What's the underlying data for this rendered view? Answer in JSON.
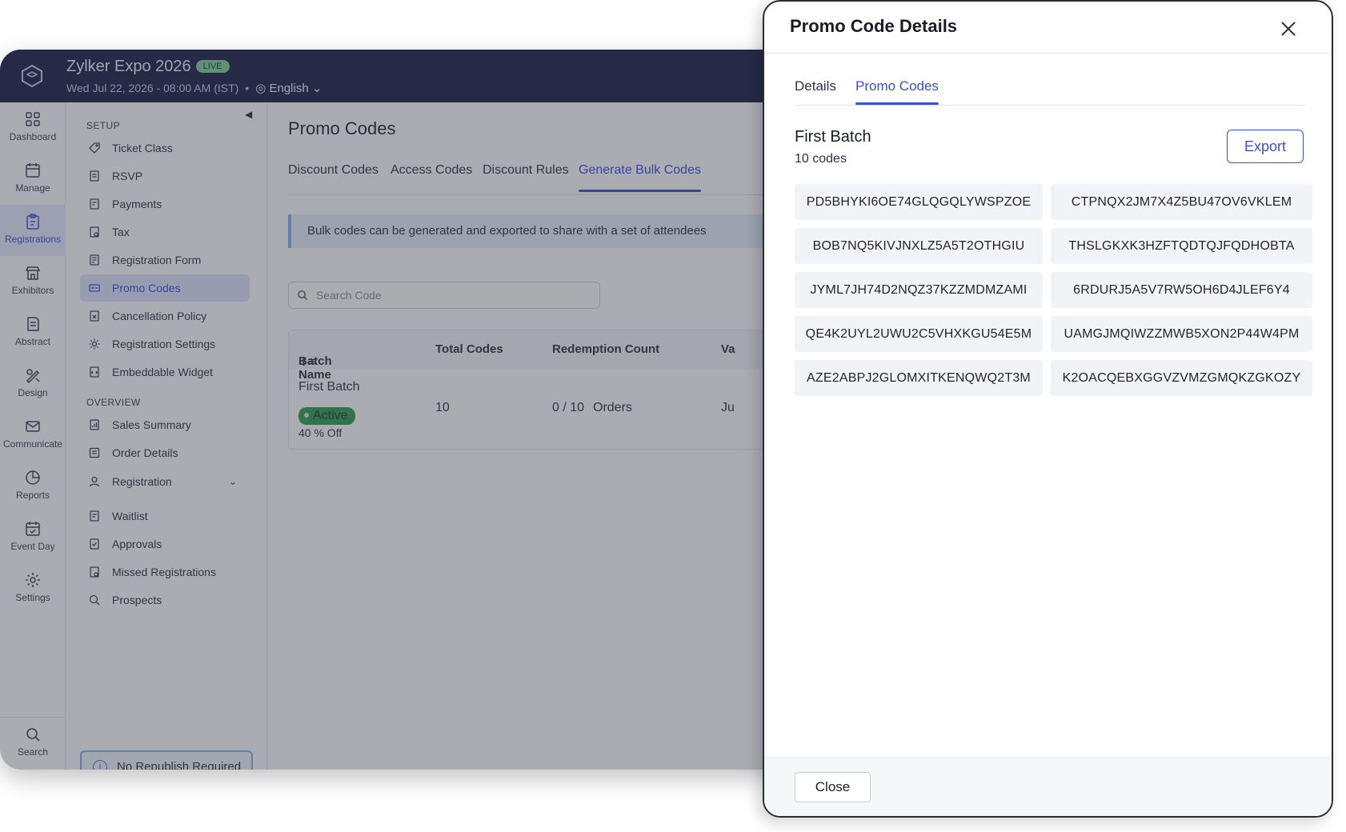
{
  "app": {
    "event_title": "Zylker Expo 2026",
    "live_badge": "LIVE",
    "event_datetime": "Wed Jul 22, 2026 - 08:00 AM (IST)",
    "separator": "•",
    "language": "English"
  },
  "rail": {
    "items": [
      {
        "label": "Dashboard",
        "icon": "dashboard-icon"
      },
      {
        "label": "Manage",
        "icon": "manage-icon"
      },
      {
        "label": "Registrations",
        "icon": "registrations-icon",
        "active": true
      },
      {
        "label": "Exhibitors",
        "icon": "exhibitors-icon"
      },
      {
        "label": "Abstract",
        "icon": "abstract-icon"
      },
      {
        "label": "Design",
        "icon": "design-icon"
      },
      {
        "label": "Communicate",
        "icon": "communicate-icon"
      },
      {
        "label": "Reports",
        "icon": "reports-icon"
      },
      {
        "label": "Event Day",
        "icon": "event-day-icon"
      },
      {
        "label": "Settings",
        "icon": "settings-icon"
      }
    ],
    "search_label": "Search"
  },
  "sidebar": {
    "setup_heading": "SETUP",
    "setup_items": [
      "Ticket Class",
      "RSVP",
      "Payments",
      "Tax",
      "Registration Form",
      "Promo Codes",
      "Cancellation Policy",
      "Registration Settings",
      "Embeddable Widget"
    ],
    "overview_heading": "OVERVIEW",
    "overview_items": [
      "Sales Summary",
      "Order Details",
      "Registration",
      "Waitlist",
      "Approvals",
      "Missed Registrations",
      "Prospects"
    ],
    "active_item": "Promo Codes",
    "republish_label": "No Republish Required"
  },
  "main": {
    "page_title": "Promo Codes",
    "tabs": [
      "Discount Codes",
      "Access Codes",
      "Discount Rules",
      "Generate Bulk Codes"
    ],
    "active_tab": "Generate Bulk Codes",
    "info_banner": "Bulk codes can be generated and exported to share with a set of attendees",
    "search_placeholder": "Search Code",
    "table": {
      "headers": [
        "Batch Name",
        "Total Codes",
        "Redemption Count",
        "Va"
      ],
      "row": {
        "batch_name": "First Batch",
        "status": "Active",
        "discount": "40 % Off",
        "total_codes": "10",
        "redemption": "0 / 10",
        "redemption_unit": "Orders",
        "valid_fragment": "Ju"
      }
    }
  },
  "drawer": {
    "title": "Promo Code Details",
    "tabs": [
      "Details",
      "Promo Codes"
    ],
    "active_tab": "Promo Codes",
    "batch_name": "First Batch",
    "batch_count": "10 codes",
    "export_label": "Export",
    "codes": [
      "PD5BHYKI6OE74GLQGQLYWSPZOE",
      "CTPNQX2JM7X4Z5BU47OV6VKLEM",
      "BOB7NQ5KIVJNXLZ5A5T2OTHGIU",
      "THSLGKXK3HZFTQDTQJFQDHOBTA",
      "JYML7JH74D2NQZ37KZZMDMZAMI",
      "6RDURJ5A5V7RW5OH6D4JLEF6Y4",
      "QE4K2UYL2UWU2C5VHXKGU54E5M",
      "UAMGJMQIWZZMWB5XON2P44W4PM",
      "AZE2ABPJ2GLOMXITKENQWQ2T3M",
      "K2OACQEBXGGVZVMZGMQKZGKOZY"
    ],
    "close_label": "Close"
  },
  "colors": {
    "header_bg": "#1b1f45",
    "accent": "#3a4fd8",
    "active_badge": "#2e9d4f",
    "live_badge": "#7fd19a"
  }
}
